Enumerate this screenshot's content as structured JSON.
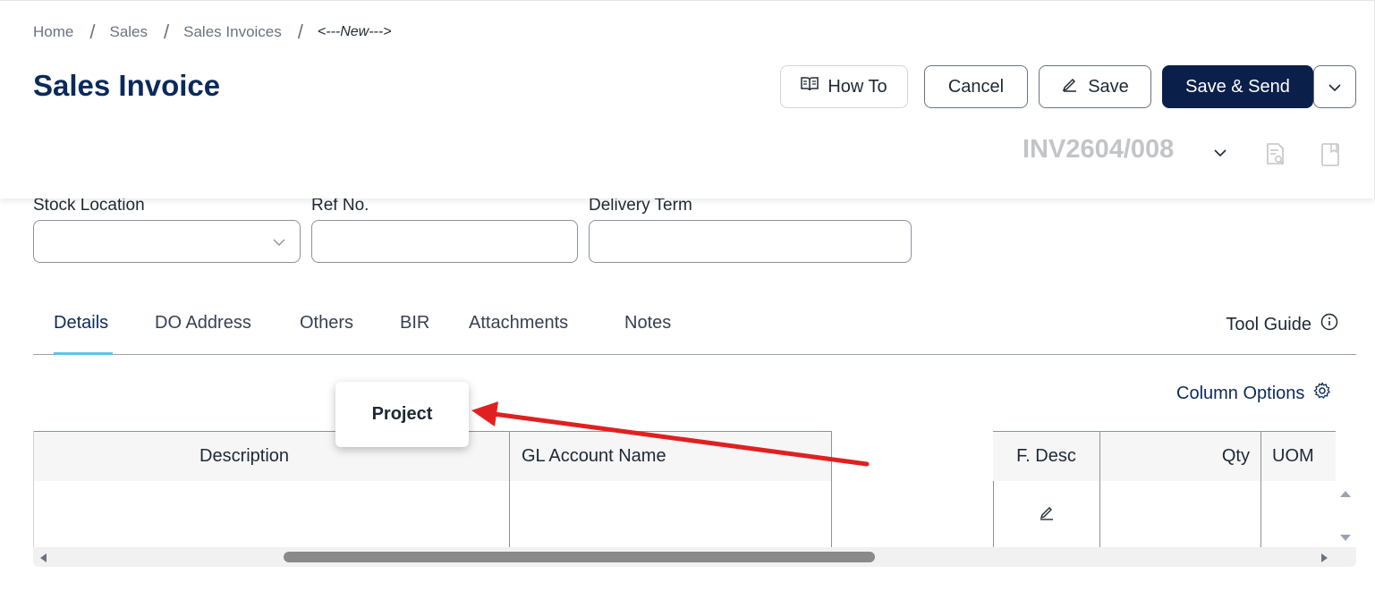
{
  "breadcrumb": {
    "home": "Home",
    "sales": "Sales",
    "invoices": "Sales Invoices",
    "current": "<---New--->",
    "separator": "/"
  },
  "page": {
    "title": "Sales Invoice"
  },
  "toolbar": {
    "how_to": "How To",
    "cancel": "Cancel",
    "save": "Save",
    "save_send": "Save & Send"
  },
  "invoice": {
    "number": "INV2604/008"
  },
  "fields": {
    "stock_location": {
      "label": "Stock Location",
      "value": ""
    },
    "ref_no": {
      "label": "Ref No.",
      "value": ""
    },
    "delivery_term": {
      "label": "Delivery Term",
      "value": ""
    }
  },
  "tabs": [
    {
      "label": "Details",
      "active": true
    },
    {
      "label": "DO Address",
      "active": false
    },
    {
      "label": "Others",
      "active": false
    },
    {
      "label": "BIR",
      "active": false
    },
    {
      "label": "Attachments",
      "active": false
    },
    {
      "label": "Notes",
      "active": false
    }
  ],
  "tool_guide": "Tool Guide",
  "column_options": "Column Options",
  "grid": {
    "headers": [
      "",
      "Description",
      "GL Account Name",
      "",
      "F. Desc",
      "Qty",
      "UOM"
    ]
  },
  "tooltip": {
    "label": "Project"
  },
  "colors": {
    "title": "#0b2a5b",
    "primary_button": "#0b1f4b",
    "tab_underline": "#5bc4e8",
    "annotation_arrow": "#e02020"
  },
  "icons": [
    "book-icon",
    "pencil-icon",
    "chevron-down-icon",
    "document-search-icon",
    "bookmark-icon",
    "info-icon",
    "gear-icon",
    "edit-icon"
  ]
}
